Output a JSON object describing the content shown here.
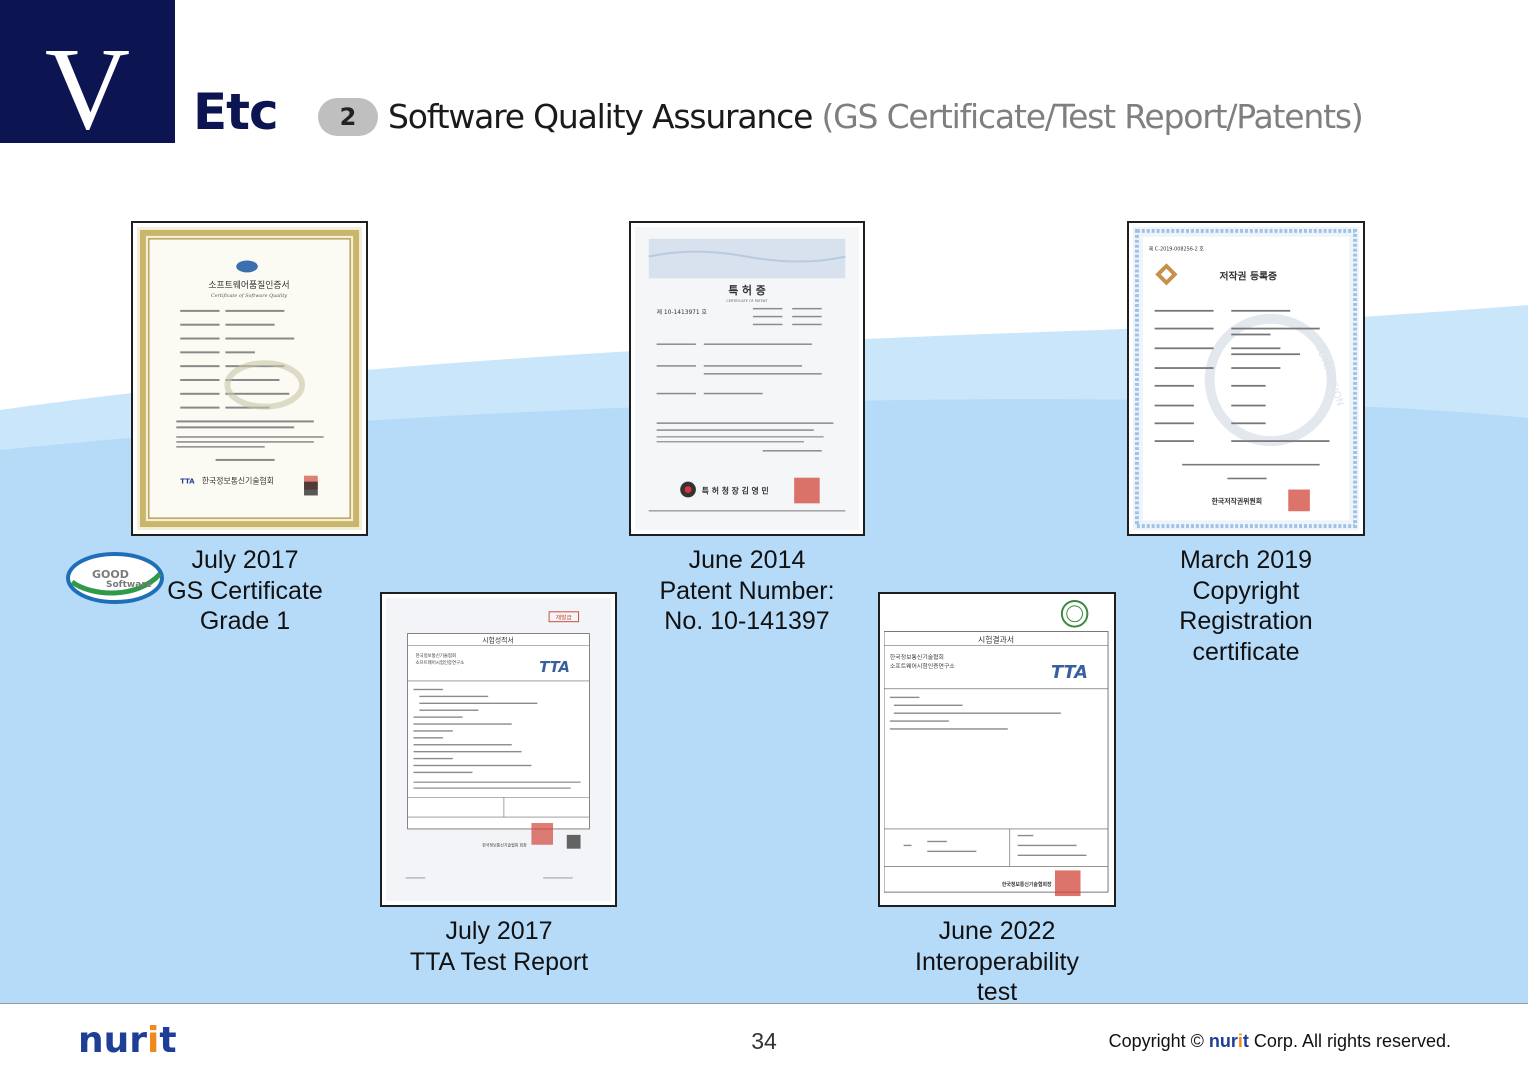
{
  "header": {
    "chapter_numeral": "V",
    "section_title": "Etc",
    "sub_number": "2",
    "sub_title": "Software Quality Assurance",
    "sub_title_paren": "(GS Certificate/Test Report/Patents)"
  },
  "documents": [
    {
      "id": "gs-certificate",
      "caption": [
        "July 2017",
        "GS Certificate",
        "Grade 1"
      ],
      "doc_title": "소프트웨어품질인증서",
      "doc_subtitle": "Certificate of Software Quality",
      "issuer": "한국정보통신기술협회",
      "issuer_short": "TTA"
    },
    {
      "id": "patent-certificate",
      "caption": [
        "June 2014",
        "Patent Number:",
        "No. 10-141397"
      ],
      "doc_title": "특 허 증",
      "doc_subtitle": "CERTIFICATE OF PATENT",
      "patent_no": "제 10-1413971 호",
      "issuer": "특 허 청 장  김 영 민"
    },
    {
      "id": "copyright-certificate",
      "caption": [
        "March 2019",
        "Copyright",
        "Registration",
        "certificate"
      ],
      "doc_no": "제 C-2019-008256-2 호",
      "doc_title": "저작권 등록증",
      "issuer": "한국저작권위원회",
      "watermark": "COMMISSION"
    },
    {
      "id": "tta-test-report",
      "caption": [
        "July 2017",
        "TTA Test Report"
      ],
      "doc_title": "시험성적서",
      "stamp": "재발급",
      "org_line1": "한국정보통신기술협회",
      "org_line2": "소프트웨어시험인증연구소",
      "issuer_short": "TTA",
      "issuer": "한국정보통신기술협회 회장"
    },
    {
      "id": "interoperability-test",
      "caption": [
        "June 2022",
        "Interoperability",
        "test"
      ],
      "doc_title": "시험결과서",
      "org_line1": "한국정보통신기술협회",
      "org_line2": "소프트웨어시험인증연구소",
      "issuer_short": "TTA",
      "issuer": "한국정보통신기술협회장"
    }
  ],
  "logo_badge": {
    "line1": "GOOD",
    "line2": "Software"
  },
  "footer": {
    "logo_part1": "nur",
    "logo_accent": "i",
    "logo_part2": "t",
    "page_number": "34",
    "copyright_prefix": "Copyright © ",
    "copyright_brand1": "nur",
    "copyright_brand_accent": "i",
    "copyright_brand2": "t",
    "copyright_suffix": " Corp. All rights reserved."
  },
  "colors": {
    "navy": "#0c1552",
    "wave_light": "#c6e4fb",
    "wave_dark": "#b3d9f8",
    "logo_blue": "#1f3f96",
    "logo_orange": "#f08a1c"
  }
}
